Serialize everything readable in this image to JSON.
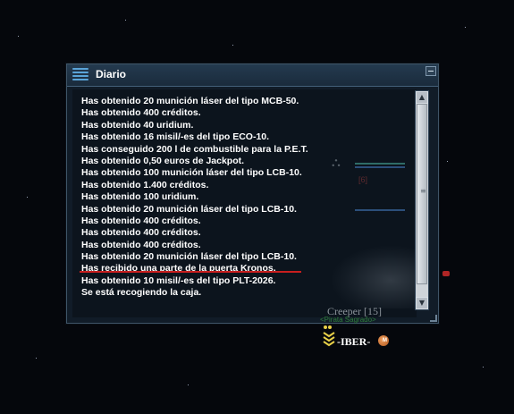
{
  "window": {
    "title": "Diario",
    "icon": "list-icon",
    "minimize_icon": "minimize-icon"
  },
  "log": [
    "Has obtenido 20 munición láser del tipo MCB-50.",
    "Has obtenido 400 créditos.",
    "Has obtenido 40 uridium.",
    "Has obtenido 16 misil/-es del tipo ECO-10.",
    "Has conseguido 200 l de combustible para la P.E.T.",
    "Has obtenido 0,50 euros de Jackpot.",
    "Has obtenido 100 munición láser del tipo LCB-10.",
    "Has obtenido 1.400 créditos.",
    "Has obtenido 100 uridium.",
    "Has obtenido 20 munición láser del tipo LCB-10.",
    "Has obtenido 400 créditos.",
    "Has obtenido 400 créditos.",
    "Has obtenido 400 créditos.",
    "Has obtenido 20 munición láser del tipo LCB-10.",
    "Has recibido una parte de la puerta Kronos.",
    "Has obtenido 10 misil/-es del tipo PLT-2026.",
    "Se está recogiendo la caja."
  ],
  "highlight": {
    "line_index": 14,
    "color": "#c81e1e"
  },
  "scrollbar": {
    "up_icon": "arrow-up-icon",
    "down_icon": "arrow-down-icon"
  },
  "world": {
    "npc_label": "Creeper [15]",
    "npc_sub": "<Pirata Sagrado>",
    "npc_bg_label": "[6]",
    "player_name": "-IBER-",
    "player_rank_icon": "rank-chevrons-icon",
    "faction_icon": "mmo-faction-icon"
  },
  "colors": {
    "window_bg": "#111c28",
    "title_bar": "#243a4f",
    "text": "#ffffff",
    "highlight_underline": "#c81e1e"
  }
}
